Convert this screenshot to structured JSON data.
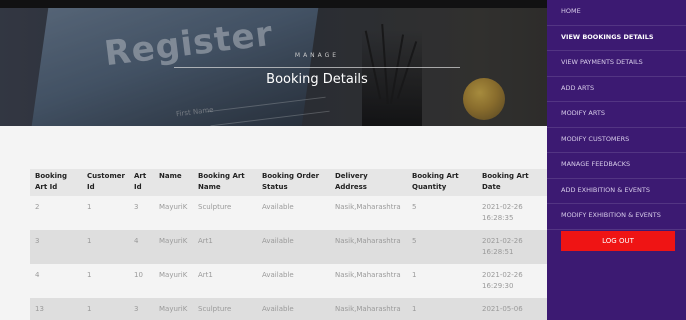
{
  "hero": {
    "background_text": "Register",
    "form_label": "First Name",
    "subtitle": "MANAGE",
    "title": "Booking Details"
  },
  "table": {
    "headers": [
      "Booking Art Id",
      "Customer Id",
      "Art Id",
      "Name",
      "Booking Art Name",
      "Booking Order Status",
      "Delivery Address",
      "Booking Art Quantity",
      "Booking Art Date"
    ],
    "rows": [
      [
        "2",
        "1",
        "3",
        "MayuriK",
        "Sculpture",
        "Available",
        "Nasik,Maharashtra",
        "5",
        "2021-02-26 16:28:35"
      ],
      [
        "3",
        "1",
        "4",
        "MayuriK",
        "Art1",
        "Available",
        "Nasik,Maharashtra",
        "5",
        "2021-02-26 16:28:51"
      ],
      [
        "4",
        "1",
        "10",
        "MayuriK",
        "Art1",
        "Available",
        "Nasik,Maharashtra",
        "1",
        "2021-02-26 16:29:30"
      ],
      [
        "13",
        "1",
        "3",
        "MayuriK",
        "Sculpture",
        "Available",
        "Nasik,Maharashtra",
        "1",
        "2021-05-06"
      ]
    ]
  },
  "sidebar": {
    "items": [
      {
        "label": "HOME"
      },
      {
        "label": "VIEW BOOKINGS DETAILS"
      },
      {
        "label": "VIEW PAYMENTS DETAILS"
      },
      {
        "label": "ADD ARTS"
      },
      {
        "label": "MODIFY ARTS"
      },
      {
        "label": "MODIFY CUSTOMERS"
      },
      {
        "label": "MANAGE FEEDBACKS"
      },
      {
        "label": "ADD EXHIBITION & EVENTS"
      },
      {
        "label": "MODIFY EXHIBITION & EVENTS"
      }
    ],
    "active_index": 1,
    "logout_label": "LOG OUT"
  },
  "colors": {
    "sidebar_bg": "#3c1a72",
    "logout_bg": "#ef1414",
    "header_row_bg": "#e6e6e6",
    "stripe_bg": "#dedede"
  }
}
